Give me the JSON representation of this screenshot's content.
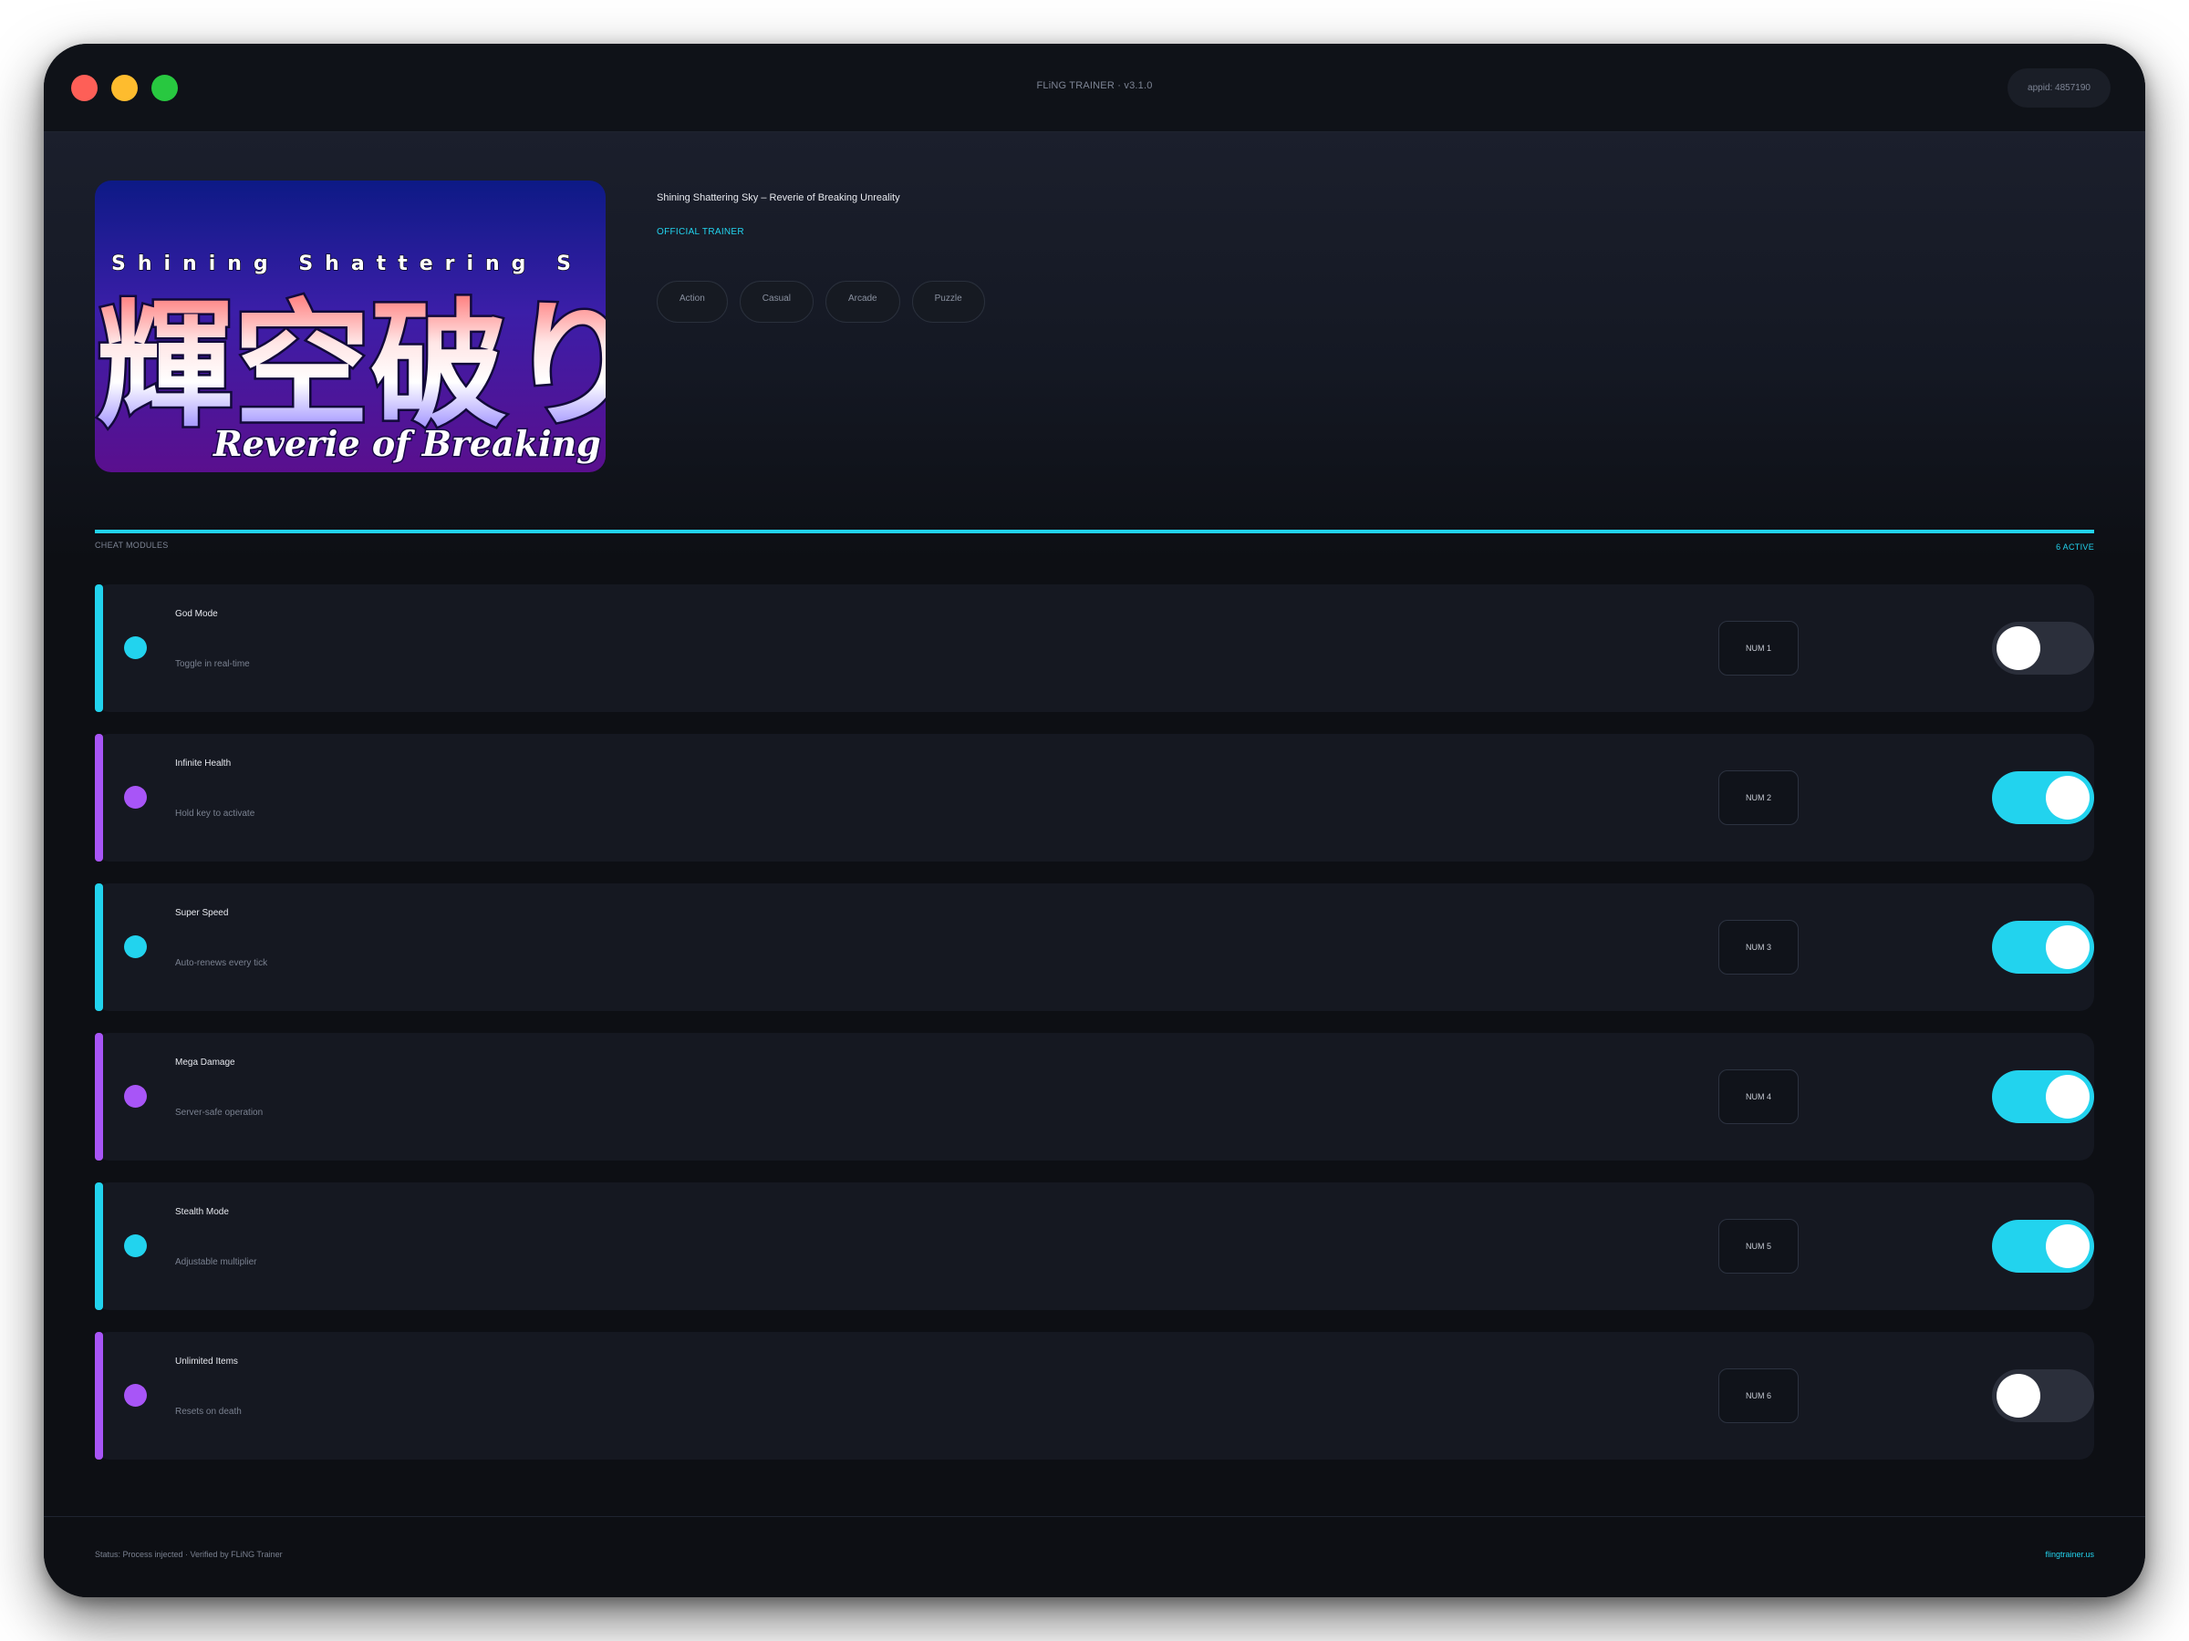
{
  "window": {
    "title": "FLiNG TRAINER · v3.1.0",
    "appid": "appid: 4857190"
  },
  "game": {
    "title": "Shining Shattering Sky – Reverie of Breaking Unreality",
    "official_label": "OFFICIAL TRAINER",
    "tags": [
      "Action",
      "Casual",
      "Arcade",
      "Puzzle"
    ],
    "cover": {
      "line1": "Shining Shattering S",
      "kanji": "輝空破り",
      "subtitle": "Reverie of Breaking Unrea"
    }
  },
  "section": {
    "label": "CHEAT MODULES",
    "active_count": "6 ACTIVE"
  },
  "modules": [
    {
      "name": "God Mode",
      "description": "Toggle in real-time",
      "hotkey": "NUM 1",
      "enabled": false,
      "accent": "#22d3ee"
    },
    {
      "name": "Infinite Health",
      "description": "Hold key to activate",
      "hotkey": "NUM 2",
      "enabled": true,
      "accent": "#a855f7"
    },
    {
      "name": "Super Speed",
      "description": "Auto-renews every tick",
      "hotkey": "NUM 3",
      "enabled": true,
      "accent": "#22d3ee"
    },
    {
      "name": "Mega Damage",
      "description": "Server-safe operation",
      "hotkey": "NUM 4",
      "enabled": true,
      "accent": "#a855f7"
    },
    {
      "name": "Stealth Mode",
      "description": "Adjustable multiplier",
      "hotkey": "NUM 5",
      "enabled": true,
      "accent": "#22d3ee"
    },
    {
      "name": "Unlimited Items",
      "description": "Resets on death",
      "hotkey": "NUM 6",
      "enabled": false,
      "accent": "#a855f7"
    }
  ],
  "footer": {
    "status": "Status: Process injected · Verified by FLiNG Trainer",
    "link": "flingtrainer.us"
  },
  "colors": {
    "accent_cyan": "#22d3ee",
    "accent_purple": "#a855f7",
    "background": "#0d0f14"
  }
}
